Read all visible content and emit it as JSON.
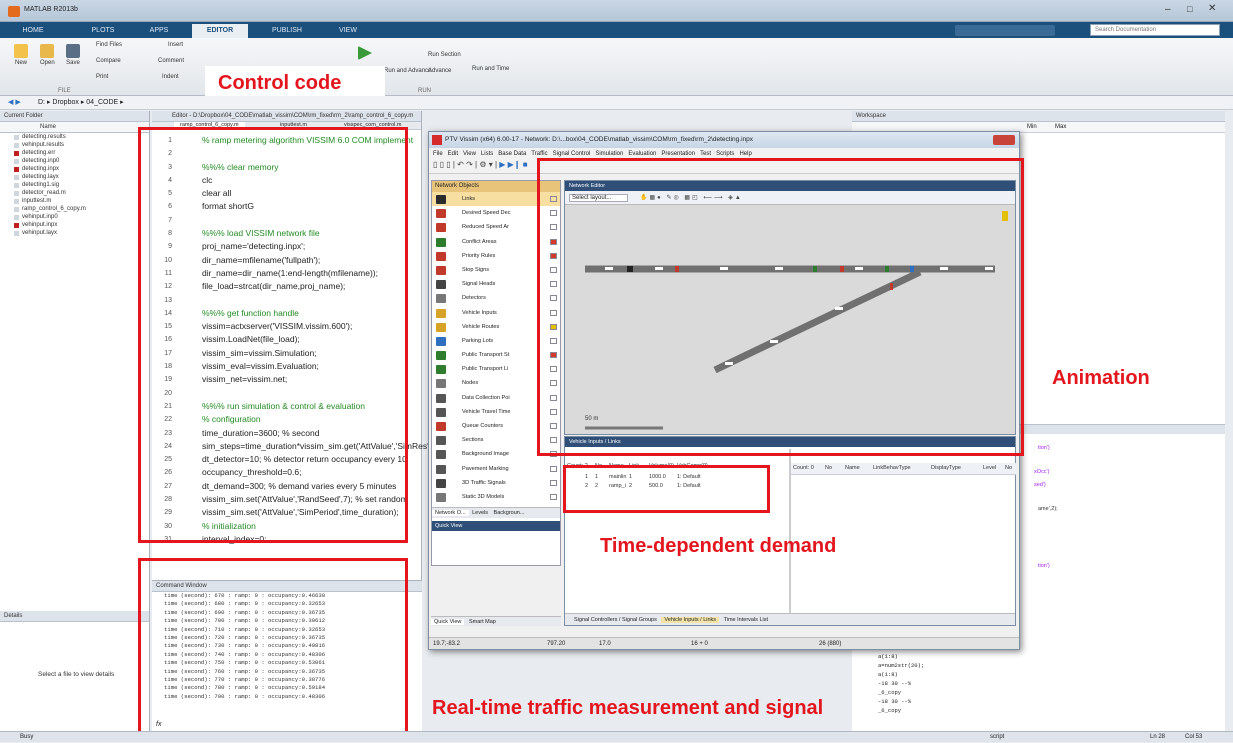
{
  "app": {
    "title": "MATLAB R2013b"
  },
  "tabs": [
    "HOME",
    "PLOTS",
    "APPS",
    "EDITOR",
    "PUBLISH",
    "VIEW"
  ],
  "search": {
    "placeholder": "Search Documentation"
  },
  "ribbon": {
    "new": "New",
    "open": "Open",
    "save": "Save",
    "find_files": "Find Files",
    "compare": "Compare",
    "print": "Print",
    "insert": "Insert",
    "comment": "Comment",
    "indent": "Indent",
    "run_section": "Run Section",
    "advance": "Advance",
    "run_and_time": "Run and Time",
    "run_and_advance": "Run and Advance",
    "group_file": "FILE",
    "group_run": "RUN"
  },
  "breadcrumb": [
    "D:",
    "Dropbox",
    "04_CODE"
  ],
  "current_folder": {
    "title": "Current Folder",
    "column": "Name",
    "files": [
      {
        "name": "detecting.results",
        "red": false
      },
      {
        "name": "vehinput.results",
        "red": false
      },
      {
        "name": "detecting.err",
        "red": true
      },
      {
        "name": "detecting.inp0",
        "red": false
      },
      {
        "name": "detecting.inpx",
        "red": true
      },
      {
        "name": "detecting.layx",
        "red": false
      },
      {
        "name": "detecting1.sig",
        "red": false
      },
      {
        "name": "detector_read.m",
        "red": false
      },
      {
        "name": "inputtest.m",
        "red": false
      },
      {
        "name": "ramp_control_6_copy.m",
        "red": false
      },
      {
        "name": "vehinput.inp0",
        "red": false
      },
      {
        "name": "vehinput.inpx",
        "red": true
      },
      {
        "name": "vehinput.layx",
        "red": false
      }
    ],
    "details_title": "Details",
    "details_text": "Select a file to view details"
  },
  "editor": {
    "title": "Editor - D:\\Dropbox\\04_CODE\\matlab_vissim\\COM\\rm_fixed\\rm_2\\ramp_control_6_copy.m",
    "tabs": [
      "ramp_control_6_copy.m",
      "inputtest.m",
      "visspec_com_control.m"
    ],
    "lines": [
      {
        "n": "1",
        "t": "% ramp metering algorithm VISSIM 6.0 COM implement",
        "c": "cm"
      },
      {
        "n": "2",
        "t": "",
        "c": ""
      },
      {
        "n": "3",
        "t": "%%% clear memory",
        "c": "cm"
      },
      {
        "n": "4",
        "t": "clc",
        "c": ""
      },
      {
        "n": "5",
        "t": "clear all",
        "c": ""
      },
      {
        "n": "6",
        "t": "format shortG",
        "c": ""
      },
      {
        "n": "7",
        "t": "",
        "c": ""
      },
      {
        "n": "8",
        "t": "%%% load VISSIM network file",
        "c": "cm"
      },
      {
        "n": "9",
        "t": "proj_name='detecting.inpx';",
        "c": ""
      },
      {
        "n": "10",
        "t": "dir_name=mfilename('fullpath');",
        "c": ""
      },
      {
        "n": "11",
        "t": "dir_name=dir_name(1:end-length(mfilename));",
        "c": ""
      },
      {
        "n": "12",
        "t": "file_load=strcat(dir_name,proj_name);",
        "c": ""
      },
      {
        "n": "13",
        "t": "",
        "c": ""
      },
      {
        "n": "14",
        "t": "%%% get function handle",
        "c": "cm"
      },
      {
        "n": "15",
        "t": "vissim=actxserver('VISSIM.vissim.600');",
        "c": ""
      },
      {
        "n": "16",
        "t": "vissim.LoadNet(file_load);",
        "c": ""
      },
      {
        "n": "17",
        "t": "vissim_sim=vissim.Simulation;",
        "c": ""
      },
      {
        "n": "18",
        "t": "vissim_eval=vissim.Evaluation;",
        "c": ""
      },
      {
        "n": "19",
        "t": "vissim_net=vissim.net;",
        "c": ""
      },
      {
        "n": "20",
        "t": "",
        "c": ""
      },
      {
        "n": "21",
        "t": "%%% run simulation & control & evaluation",
        "c": "cm"
      },
      {
        "n": "22",
        "t": "% configuration",
        "c": "cm"
      },
      {
        "n": "23",
        "t": "time_duration=3600; % second",
        "c": ""
      },
      {
        "n": "24",
        "t": "sim_steps=time_duration*vissim_sim.get('AttValue','SimRes')",
        "c": ""
      },
      {
        "n": "25",
        "t": "dt_detector=10; % detector return occupancy every 10",
        "c": ""
      },
      {
        "n": "26",
        "t": "occupancy_threshold=0.6;",
        "c": ""
      },
      {
        "n": "27",
        "t": "dt_demand=300; % demand varies every 5 minutes",
        "c": ""
      },
      {
        "n": "28",
        "t": "vissim_sim.set('AttValue','RandSeed',7); % set random",
        "c": ""
      },
      {
        "n": "29",
        "t": "vissim_sim.set('AttValue','SimPeriod',time_duration);",
        "c": ""
      },
      {
        "n": "30",
        "t": "% initialization",
        "c": "cm"
      },
      {
        "n": "31",
        "t": "interval_index=0;",
        "c": ""
      }
    ]
  },
  "command_window": {
    "title": "Command Window",
    "lines": [
      "time (second): 670 : ramp: 0 : occupancy:0.46630",
      "time (second): 680 : ramp: 0 : occupancy:0.32653",
      "time (second): 690 : ramp: 0 : occupancy:0.36735",
      "time (second): 700 : ramp: 0 : occupancy:0.30612",
      "time (second): 710 : ramp: 0 : occupancy:0.32653",
      "time (second): 720 : ramp: 0 : occupancy:0.36735",
      "time (second): 730 : ramp: 0 : occupancy:0.40816",
      "time (second): 740 : ramp: 0 : occupancy:0.48306",
      "time (second): 750 : ramp: 0 : occupancy:0.53061",
      "time (second): 760 : ramp: 0 : occupancy:0.36735",
      "time (second): 770 : ramp: 0 : occupancy:0.38776",
      "time (second): 780 : ramp: 0 : occupancy:0.59184",
      "time (second): 790 : ramp: 0 : occupancy:0.48306"
    ],
    "prompt": "fx"
  },
  "workspace": {
    "title": "Workspace",
    "columns": [
      "Min",
      "Max"
    ],
    "history": [
      "a(1:8)",
      "a=num2str(20);",
      "a(1:8)",
      "-18 30 --%",
      "_6_copy",
      "-18 30 --%",
      "_6_copy"
    ],
    "fragments": [
      "tion')",
      "xOcc')",
      "sed')",
      "ame',2);",
      "tion')"
    ]
  },
  "vissim": {
    "title": "PTV Vissim (x64) 6.00-17 - Network: D:\\...box\\04_CODE\\matlab_vissim\\COM\\rm_fixed\\rm_2\\detecting.inpx",
    "menu": [
      "File",
      "Edit",
      "View",
      "Lists",
      "Base Data",
      "Traffic",
      "Signal Control",
      "Simulation",
      "Evaluation",
      "Presentation",
      "Test",
      "Scripts",
      "Help"
    ],
    "network_objects_title": "Network Objects",
    "network_objects": [
      {
        "label": "Links",
        "color": "#2b2b2b",
        "bar": ""
      },
      {
        "label": "Desired Speed Dec",
        "color": "#c0392b",
        "bar": ""
      },
      {
        "label": "Reduced Speed Ar",
        "color": "#c0392b",
        "bar": ""
      },
      {
        "label": "Conflict Areas",
        "color": "#2d7d2d",
        "bar": "#d43a2a"
      },
      {
        "label": "Priority Rules",
        "color": "#c0392b",
        "bar": "#d43a2a"
      },
      {
        "label": "Stop Signs",
        "color": "#c0392b",
        "bar": ""
      },
      {
        "label": "Signal Heads",
        "color": "#444444",
        "bar": ""
      },
      {
        "label": "Detectors",
        "color": "#777777",
        "bar": ""
      },
      {
        "label": "Vehicle Inputs",
        "color": "#d6a326",
        "bar": ""
      },
      {
        "label": "Vehicle Routes",
        "color": "#d6a326",
        "bar": "#e5c000"
      },
      {
        "label": "Parking Lots",
        "color": "#2f6fc0",
        "bar": ""
      },
      {
        "label": "Public Transport St",
        "color": "#2d7d2d",
        "bar": "#d43a2a"
      },
      {
        "label": "Public Transport Li",
        "color": "#2d7d2d",
        "bar": ""
      },
      {
        "label": "Nodes",
        "color": "#777777",
        "bar": ""
      },
      {
        "label": "Data Collection Poi",
        "color": "#555555",
        "bar": ""
      },
      {
        "label": "Vehicle Travel Time",
        "color": "#555555",
        "bar": ""
      },
      {
        "label": "Queue Counters",
        "color": "#c0392b",
        "bar": ""
      },
      {
        "label": "Sections",
        "color": "#555555",
        "bar": ""
      },
      {
        "label": "Background Image",
        "color": "#555555",
        "bar": ""
      },
      {
        "label": "Pavement Marking",
        "color": "#555555",
        "bar": ""
      },
      {
        "label": "3D Traffic Signals",
        "color": "#444444",
        "bar": ""
      },
      {
        "label": "Static 3D Models",
        "color": "#777777",
        "bar": ""
      }
    ],
    "panel_tabs": [
      "Network O...",
      "Levels",
      "Backgroun..."
    ],
    "quick_view_title": "Quick View",
    "quick_tabs": [
      "Quick View",
      "Smart Map"
    ],
    "network_editor_title": "Network Editor",
    "layout_select": "Select layout...",
    "scale_label": "50 m",
    "list_title": "Vehicle Inputs / Links",
    "table1": {
      "columns": [
        "Count: 2",
        "No",
        "Name",
        "Link",
        "Volume(0)",
        "VehComp(0)"
      ],
      "rows": [
        [
          "1",
          "1",
          "mainlin",
          "1",
          "1000.0",
          "1: Default"
        ],
        [
          "2",
          "2",
          "ramp_i",
          "2",
          "500.0",
          "1: Default"
        ]
      ]
    },
    "table2": {
      "columns": [
        "Count: 0",
        "No",
        "Name",
        "LinkBehavType",
        "DisplayType",
        "Level",
        "No"
      ]
    },
    "bottom_tabs": [
      "Signal Controllers / Signal Groups",
      "Vehicle Inputs / Links",
      "Time Intervals List"
    ],
    "status": [
      "19.7;-83.2",
      "797.20",
      "17.0",
      "16 + 0",
      "26 (880)"
    ]
  },
  "annotations": {
    "control_code": "Control code",
    "animation": "Animation",
    "demand": "Time-dependent demand",
    "measurement": "Real-time traffic measurement and signal"
  },
  "statusbar": {
    "busy": "Busy",
    "script": "script",
    "ln": "Ln 28",
    "col": "Col 53"
  },
  "colors": {
    "annotation": "#e3161e",
    "tabbar": "#1b4f7c"
  }
}
